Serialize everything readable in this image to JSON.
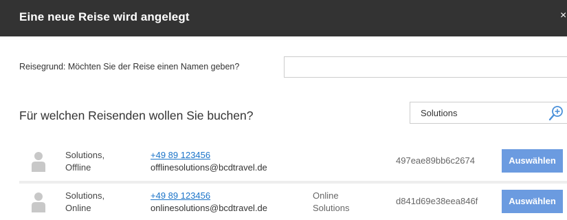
{
  "dialog": {
    "title": "Eine neue Reise wird angelegt",
    "close_symbol": "×"
  },
  "reason": {
    "label": "Reisegrund: Möchten Sie der Reise einen Namen geben?",
    "value": "",
    "placeholder": ""
  },
  "travelers_section": {
    "title": "Für welchen Reisenden wollen Sie buchen?"
  },
  "search": {
    "value": "Solutions",
    "icon": "search-plus-icon"
  },
  "colors": {
    "titlebar": "#333333",
    "select_button": "#6b9be0",
    "link": "#1a73c8"
  },
  "travelers": [
    {
      "name_line1": "Solutions,",
      "name_line2": "Offline",
      "phone": "+49 89 123456",
      "email": "offlinesolutions@bcdtravel.de",
      "company_line1": "",
      "company_line2": "",
      "id": "497eae89bb6c2674",
      "select_label": "Auswählen"
    },
    {
      "name_line1": "Solutions,",
      "name_line2": "Online",
      "phone": "+49 89 123456",
      "email": "onlinesolutions@bcdtravel.de",
      "company_line1": "Online",
      "company_line2": "Solutions",
      "id": "d841d69e38eea846f",
      "select_label": "Auswählen"
    }
  ]
}
